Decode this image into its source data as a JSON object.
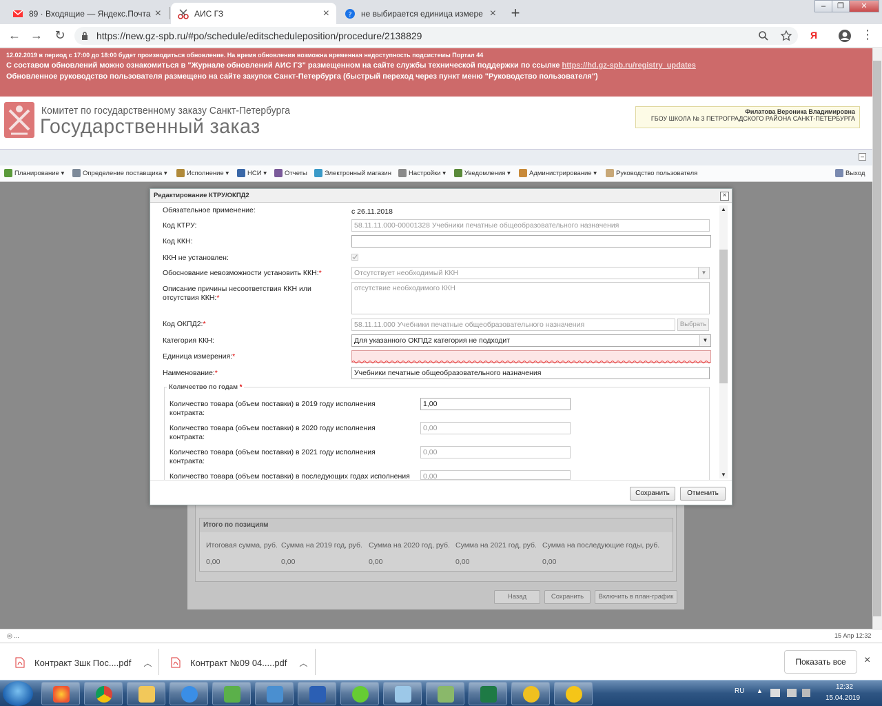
{
  "browser": {
    "tabs": [
      {
        "label": "89 · Входящие — Яндекс.Почта",
        "close": "×"
      },
      {
        "label": "АИС ГЗ",
        "close": "×"
      },
      {
        "label": "не выбирается единица измере",
        "close": "×"
      }
    ],
    "new_tab": "+",
    "url": "https://new.gz-spb.ru/#po/schedule/editscheduleposition/procedure/2138829",
    "nav": {
      "back": "←",
      "forward": "→",
      "reload": "↻"
    },
    "yandex": "Я",
    "menu": "⋮"
  },
  "notice": {
    "line1": "12.02.2019 в период с 17:00 до 18:00 будет производиться обновление. На время обновления возможна временная недоступность подсистемы Портал 44",
    "line2_prefix": "С составом обновлений можно ознакомиться в \"Журнале обновлений АИС ГЗ\" размещенном на сайте службы технической поддержки по ссылке ",
    "line2_link": "https://hd.gz-spb.ru/registry_updates",
    "line3": "Обновленное руководство пользователя размещено на сайте закупок Санкт-Петербурга (быстрый переход через пункт меню \"Руководство пользователя\")"
  },
  "header": {
    "org_line1": "Комитет по государственному заказу Санкт-Петербурга",
    "org_line2": "Государственный заказ",
    "user_name": "Филатова Вероника Владимировна",
    "user_org": "ГБОУ ШКОЛА № 3 ПЕТРОГРАДСКОГО РАЙОНА САНКТ-ПЕТЕРБУРГА"
  },
  "menu": [
    {
      "label": "Планирование ▾",
      "color": "#5a9a3a"
    },
    {
      "label": "Определение поставщика ▾",
      "color": "#7d8a99"
    },
    {
      "label": "Исполнение ▾",
      "color": "#b08a3a"
    },
    {
      "label": "НСИ ▾",
      "color": "#3a68a8"
    },
    {
      "label": "Отчеты",
      "color": "#7a5a9a"
    },
    {
      "label": "Электронный магазин",
      "color": "#3a9ac8"
    },
    {
      "label": "Настройки ▾",
      "color": "#8a8a8a"
    },
    {
      "label": "Уведомления ▾",
      "color": "#5a8a3a"
    },
    {
      "label": "Администрирование ▾",
      "color": "#c88a3a"
    },
    {
      "label": "Руководство пользователя",
      "color": "#c8a878"
    }
  ],
  "exit_label": "Выход",
  "dialog": {
    "title": "Редактирование КТРУ/ОКПД2",
    "close": "×",
    "fields": {
      "mandatory_label": "Обязательное применение:",
      "mandatory_value": "с 26.11.2018",
      "ktru_label": "Код КТРУ:",
      "ktru_value": "58.11.11.000-00001328 Учебники печатные общеобразовательного назначения",
      "kkn_label": "Код ККН:",
      "kkn_value": "",
      "kkn_not_set_label": "ККН не установлен:",
      "kkn_reason_label": "Обоснование невозможности установить ККН:",
      "kkn_reason_value": "Отсутствует необходимый ККН",
      "descr_label_1": "Описание причины несоответствия ККН или",
      "descr_label_2": "отсутствия ККН:",
      "descr_value": "отсутствие необходимого ККН",
      "okpd_label": "Код ОКПД2:",
      "okpd_value": "58.11.11.000 Учебники печатные общеобразовательного назначения",
      "choose_btn": "Выбрать",
      "kkn_cat_label": "Категория ККН:",
      "kkn_cat_value": "Для указанного ОКПД2 категория не подходит",
      "unit_label": "Единица измерения:",
      "unit_value": "",
      "name_label": "Наименование:",
      "name_value": "Учебники печатные общеобразовательного назначения",
      "req": "*"
    },
    "qty": {
      "legend": "Количество по годам",
      "rows": [
        {
          "l1": "Количество товара (объем поставки) в 2019 году исполнения",
          "l2": "контракта:",
          "value": "1,00"
        },
        {
          "l1": "Количество товара (объем поставки) в 2020 году исполнения",
          "l2": "контракта:",
          "value": "0,00"
        },
        {
          "l1": "Количество товара (объем поставки) в 2021 году исполнения",
          "l2": "контракта:",
          "value": "0,00"
        },
        {
          "l1": "Количество товара (объем поставки) в последующих годах исполнения",
          "l2": "",
          "value": "0,00"
        }
      ]
    },
    "save_btn": "Сохранить",
    "cancel_btn": "Отменить"
  },
  "summary": {
    "title": "Итого по позициям",
    "headers": [
      "Итоговая сумма, руб.",
      "Сумма на 2019 год, руб.",
      "Сумма на 2020 год, руб.",
      "Сумма на 2021 год, руб.",
      "Сумма на последующие годы, руб."
    ],
    "values": [
      "0,00",
      "0,00",
      "0,00",
      "0,00",
      "0,00"
    ]
  },
  "page_buttons": {
    "back": "Назад",
    "save": "Сохранить",
    "include": "Включить в план-график"
  },
  "status": {
    "left": "◎ ...",
    "right": "15 Апр 12:32"
  },
  "downloads": [
    {
      "name": "Контракт 3шк Пос....pdf"
    },
    {
      "name": "Контракт №09  04.....pdf"
    }
  ],
  "show_all": "Показать все",
  "downloads_close": "×",
  "tray": {
    "lang": "RU",
    "time": "12:32",
    "date": "15.04.2019"
  }
}
